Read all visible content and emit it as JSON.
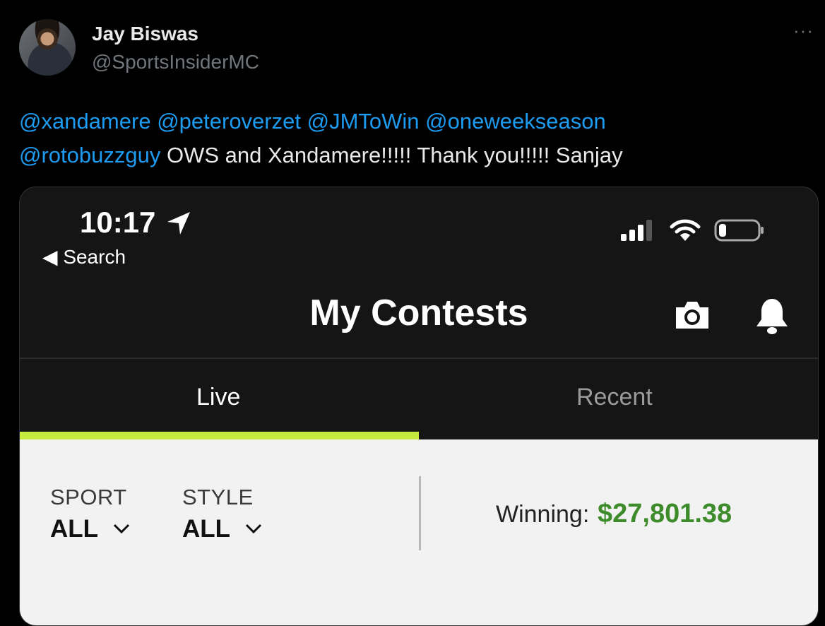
{
  "tweet": {
    "author": {
      "name": "Jay Biswas",
      "handle": "@SportsInsiderMC"
    },
    "more_label": "···",
    "mentions": [
      "@xandamere",
      "@peteroverzet",
      "@JMToWin",
      "@oneweekseason",
      "@rotobuzzguy"
    ],
    "text": "OWS and Xandamere!!!!!  Thank you!!!!!  Sanjay"
  },
  "phone": {
    "status_bar": {
      "time": "10:17",
      "back_label": "◀ Search",
      "battery_level": 0.2
    },
    "header": {
      "title": "My Contests",
      "icons": [
        "camera-icon",
        "bell-icon",
        "location-arrow-icon",
        "signal-icon",
        "wifi-icon",
        "battery-icon",
        "chevron-down-icon"
      ]
    },
    "tabs": [
      {
        "label": "Live",
        "active": true
      },
      {
        "label": "Recent",
        "active": false
      }
    ],
    "filters": {
      "sport": {
        "label": "SPORT",
        "value": "ALL"
      },
      "style": {
        "label": "STYLE",
        "value": "ALL"
      }
    },
    "winning": {
      "label": "Winning:",
      "value": "$27,801.38"
    }
  },
  "colors": {
    "mention": "#1d9bf0",
    "accent_tab": "#c6ea3e",
    "winning": "#3d8b2a"
  }
}
